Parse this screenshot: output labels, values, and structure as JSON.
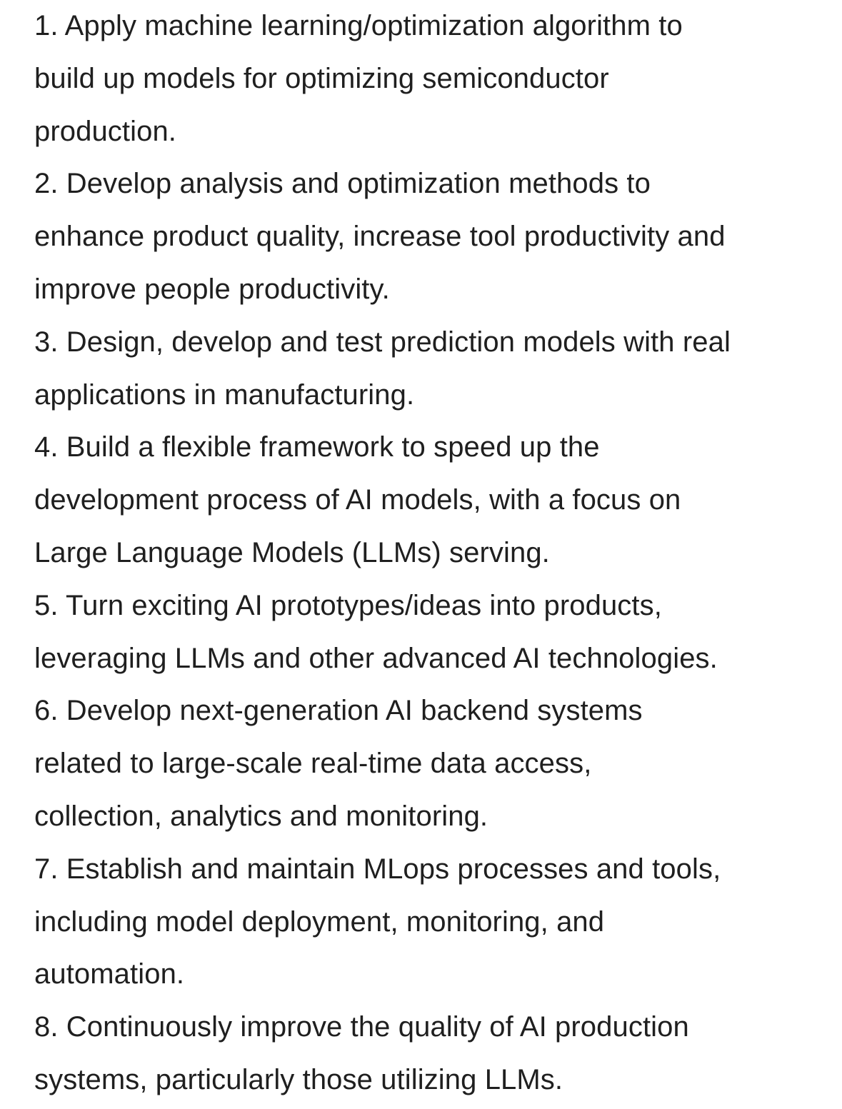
{
  "items": [
    {
      "number": "1",
      "lines": [
        "1. Apply machine learning/optimization algorithm to",
        "build up models for optimizing semiconductor",
        "production."
      ]
    },
    {
      "number": "2",
      "lines": [
        "2. Develop analysis and optimization methods to",
        "enhance product quality, increase tool productivity and",
        "improve people productivity."
      ]
    },
    {
      "number": "3",
      "lines": [
        "3. Design, develop and test prediction models with real",
        "applications in manufacturing."
      ]
    },
    {
      "number": "4",
      "lines": [
        "4. Build a flexible framework to speed up the",
        "development process of AI models, with a focus on",
        "Large Language Models (LLMs) serving."
      ]
    },
    {
      "number": "5",
      "lines": [
        "5. Turn exciting AI prototypes/ideas into products,",
        "leveraging LLMs and other advanced AI technologies."
      ]
    },
    {
      "number": "6",
      "lines": [
        "6. Develop next-generation AI backend systems",
        "related to large-scale real-time data access,",
        "collection, analytics and monitoring."
      ]
    },
    {
      "number": "7",
      "lines": [
        "7. Establish and maintain MLops processes and tools,",
        "including model deployment, monitoring, and",
        "automation."
      ]
    },
    {
      "number": "8",
      "lines": [
        "8. Continuously improve the quality of AI production",
        "systems, particularly those utilizing LLMs."
      ]
    }
  ]
}
